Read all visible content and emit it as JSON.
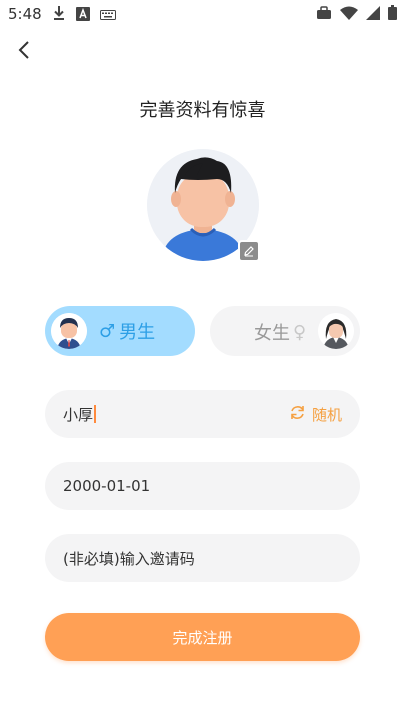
{
  "status_bar": {
    "time": "5:48",
    "left_icons": [
      "download-icon",
      "a-icon",
      "keyboard-icon"
    ],
    "right_icons": [
      "briefcase-icon",
      "wifi-icon",
      "signal-icon",
      "battery-icon"
    ]
  },
  "header": {
    "back_icon": "chevron-left-icon",
    "title": "完善资料有惊喜"
  },
  "avatar": {
    "edit_icon": "pencil-icon"
  },
  "gender": {
    "selected": "male",
    "male_label": "男生",
    "female_label": "女生",
    "male_symbol": "♂",
    "female_symbol": "♀"
  },
  "form": {
    "nickname_value": "小厚",
    "random_label": "随机",
    "birthday_value": "2000-01-01",
    "invite_placeholder": "(非必填)输入邀请码"
  },
  "submit_label": "完成注册",
  "colors": {
    "accent_orange": "#ffa055",
    "random_orange": "#f5a041",
    "male_bg": "#a3dcff",
    "male_text": "#2d9fe6",
    "field_bg": "#f4f4f5"
  }
}
